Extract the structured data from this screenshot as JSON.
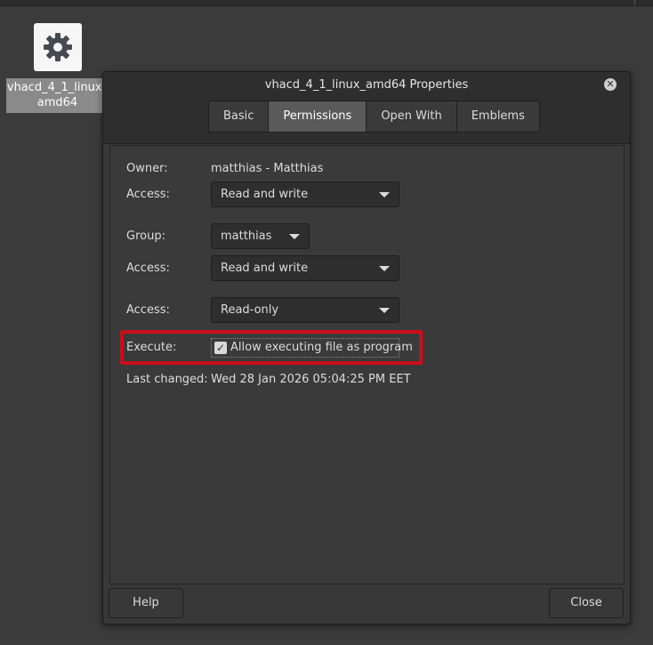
{
  "desktop": {
    "icon_label_line1": "vhacd_4_1_linux_",
    "icon_label_line2": "amd64",
    "icon_name": "gear-icon"
  },
  "dialog": {
    "title": "vhacd_4_1_linux_amd64 Properties",
    "tabs": [
      {
        "label": "Basic",
        "active": false
      },
      {
        "label": "Permissions",
        "active": true
      },
      {
        "label": "Open With",
        "active": false
      },
      {
        "label": "Emblems",
        "active": false
      }
    ],
    "permissions": {
      "owner_label": "Owner:",
      "owner_value": "matthias - Matthias",
      "owner_access_label": "Access:",
      "owner_access_value": "Read and write",
      "group_label": "Group:",
      "group_value": "matthias",
      "group_access_label": "Access:",
      "group_access_value": "Read and write",
      "others_access_label": "Access:",
      "others_access_value": "Read-only",
      "execute_label": "Execute:",
      "execute_checkbox_label": "Allow executing file as program",
      "execute_checked": true,
      "last_changed_label": "Last changed:",
      "last_changed_value": "Wed 28 Jan 2026 05:04:25 PM EET"
    },
    "help_button": "Help",
    "close_button": "Close"
  },
  "colors": {
    "highlight": "#cc0d1a",
    "active_tab": "#5a5a5a",
    "background": "#3b3b3b"
  }
}
